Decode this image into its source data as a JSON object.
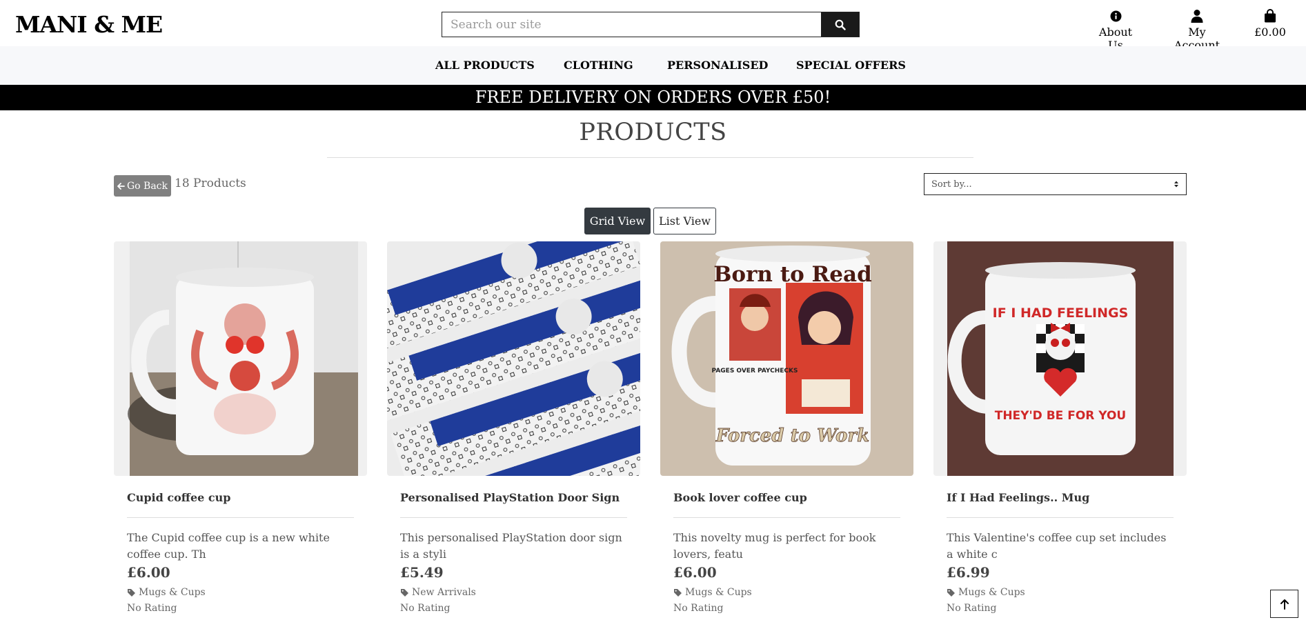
{
  "header": {
    "logo": "MANI & ME",
    "search_placeholder": "Search our site",
    "about_label": "About Us",
    "account_label": "My Account",
    "basket_total": "£0.00"
  },
  "nav": {
    "items": [
      "ALL PRODUCTS",
      "CLOTHING",
      "PERSONALISED",
      "SPECIAL OFFERS"
    ]
  },
  "banner": {
    "text": "FREE DELIVERY ON ORDERS OVER £50!"
  },
  "page": {
    "title": "PRODUCTS",
    "back_label": "Go Back",
    "count_label": "18 Products",
    "sort_label": "Sort by...",
    "grid_view_label": "Grid View",
    "list_view_label": "List View"
  },
  "products": [
    {
      "name": "Cupid coffee cup",
      "desc": "The Cupid coffee cup is a new white coffee cup. Th",
      "price": "£6.00",
      "category": "Mugs & Cups",
      "rating": "No Rating"
    },
    {
      "name": "Personalised PlayStation Door Sign",
      "desc": "This personalised PlayStation door sign is a styli",
      "price": "£5.49",
      "category": "New Arrivals",
      "rating": "No Rating"
    },
    {
      "name": "Book lover coffee cup",
      "desc": "This novelty mug is perfect for book lovers, featu",
      "price": "£6.00",
      "category": "Mugs & Cups",
      "rating": "No Rating"
    },
    {
      "name": "If I Had Feelings.. Mug",
      "desc": "This Valentine's coffee cup set includes a white c",
      "price": "£6.99",
      "category": "Mugs & Cups",
      "rating": "No Rating"
    }
  ],
  "mug_art": {
    "book_top": "Born to Read",
    "book_bottom": "Forced to Work",
    "book_mid": "PAGES OVER PAYCHECKS",
    "feelings_top": "IF I HAD FEELINGS",
    "feelings_bottom": "THEY'D BE FOR YOU"
  },
  "colors": {
    "banner_bg": "#000000",
    "nav_bg": "#f7f8fa",
    "grid_btn_bg": "#343a40",
    "back_btn_bg": "#808080"
  }
}
